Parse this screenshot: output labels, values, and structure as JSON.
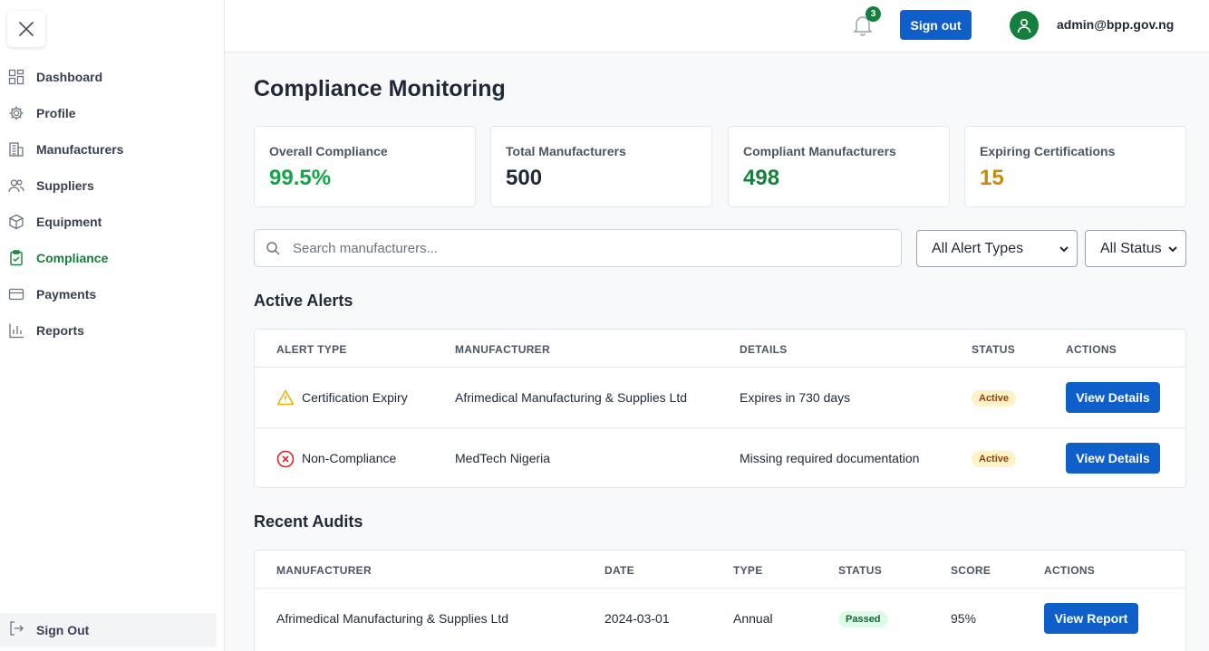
{
  "sidebar": {
    "items": [
      {
        "label": "Dashboard",
        "icon": "dashboard-icon"
      },
      {
        "label": "Profile",
        "icon": "gear-icon"
      },
      {
        "label": "Manufacturers",
        "icon": "building-icon"
      },
      {
        "label": "Suppliers",
        "icon": "users-icon"
      },
      {
        "label": "Equipment",
        "icon": "box-icon"
      },
      {
        "label": "Compliance",
        "icon": "clipboard-check-icon"
      },
      {
        "label": "Payments",
        "icon": "credit-card-icon"
      },
      {
        "label": "Reports",
        "icon": "bar-chart-icon"
      }
    ],
    "active": "Compliance",
    "signout_label": "Sign Out"
  },
  "header": {
    "notification_count": "3",
    "signout_label": "Sign out",
    "user_email": "admin@bpp.gov.ng"
  },
  "page": {
    "title": "Compliance Monitoring"
  },
  "stats": [
    {
      "label": "Overall Compliance",
      "value": "99.5%",
      "color": "#16a34a"
    },
    {
      "label": "Total Manufacturers",
      "value": "500",
      "color": "#1f2937"
    },
    {
      "label": "Compliant Manufacturers",
      "value": "498",
      "color": "#15803d"
    },
    {
      "label": "Expiring Certifications",
      "value": "15",
      "color": "#ca8a04"
    }
  ],
  "filters": {
    "search_placeholder": "Search manufacturers...",
    "alert_type": "All Alert Types",
    "status": "All Status"
  },
  "alerts": {
    "title": "Active Alerts",
    "headers": [
      "ALERT TYPE",
      "MANUFACTURER",
      "DETAILS",
      "STATUS",
      "ACTIONS"
    ],
    "rows": [
      {
        "type": "Certification Expiry",
        "icon": "warning-triangle-icon",
        "manufacturer": "Afrimedical Manufacturing & Supplies Ltd",
        "details": "Expires in 730 days",
        "status": "Active",
        "action": "View Details"
      },
      {
        "type": "Non-Compliance",
        "icon": "error-circle-icon",
        "manufacturer": "MedTech Nigeria",
        "details": "Missing required documentation",
        "status": "Active",
        "action": "View Details"
      }
    ]
  },
  "audits": {
    "title": "Recent Audits",
    "headers": [
      "MANUFACTURER",
      "DATE",
      "TYPE",
      "STATUS",
      "SCORE",
      "ACTIONS"
    ],
    "rows": [
      {
        "manufacturer": "Afrimedical Manufacturing & Supplies Ltd",
        "date": "2024-03-01",
        "type": "Annual",
        "status": "Passed",
        "score": "95%",
        "action": "View Report"
      }
    ]
  }
}
